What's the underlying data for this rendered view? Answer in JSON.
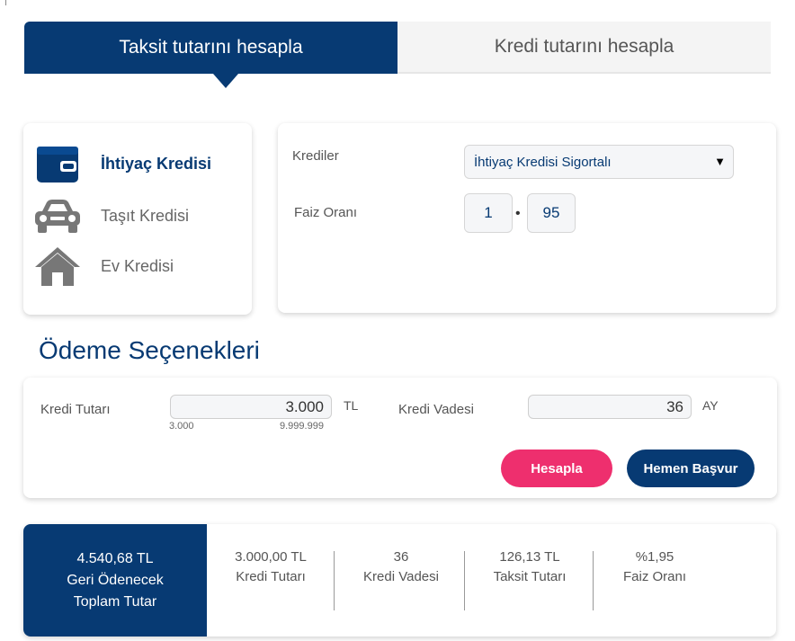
{
  "tabs": {
    "active": "Taksit tutarını hesapla",
    "inactive": "Kredi tutarını hesapla"
  },
  "loan_types": [
    {
      "label": "İhtiyaç Kredisi",
      "icon": "wallet-icon",
      "active": true
    },
    {
      "label": "Taşıt Kredisi",
      "icon": "car-icon",
      "active": false
    },
    {
      "label": "Ev Kredisi",
      "icon": "house-icon",
      "active": false
    }
  ],
  "settings": {
    "credits_label": "Krediler",
    "credits_value": "İhtiyaç Kredisi Sigortalı",
    "rate_label": "Faiz Oranı",
    "rate_whole": "1",
    "rate_separator": "•",
    "rate_decimal": "95"
  },
  "payment": {
    "title": "Ödeme Seçenekleri",
    "amount_label": "Kredi Tutarı",
    "amount_value": "3.000",
    "amount_unit": "TL",
    "amount_min": "3.000",
    "amount_max": "9.999.999",
    "term_label": "Kredi Vadesi",
    "term_value": "36",
    "term_unit": "AY",
    "calculate_button": "Hesapla",
    "apply_button": "Hemen Başvur"
  },
  "results": {
    "total_value": "4.540,68 TL",
    "total_line1": "Geri Ödenecek",
    "total_line2": "Toplam Tutar",
    "items": [
      {
        "value": "3.000,00 TL",
        "label": "Kredi Tutarı"
      },
      {
        "value": "36",
        "label": "Kredi Vadesi"
      },
      {
        "value": "126,13 TL",
        "label": "Taksit Tutarı"
      },
      {
        "value": "%1,95",
        "label": "Faiz Oranı"
      }
    ]
  },
  "colors": {
    "primary": "#073a73",
    "accent": "#ee2f6e"
  }
}
